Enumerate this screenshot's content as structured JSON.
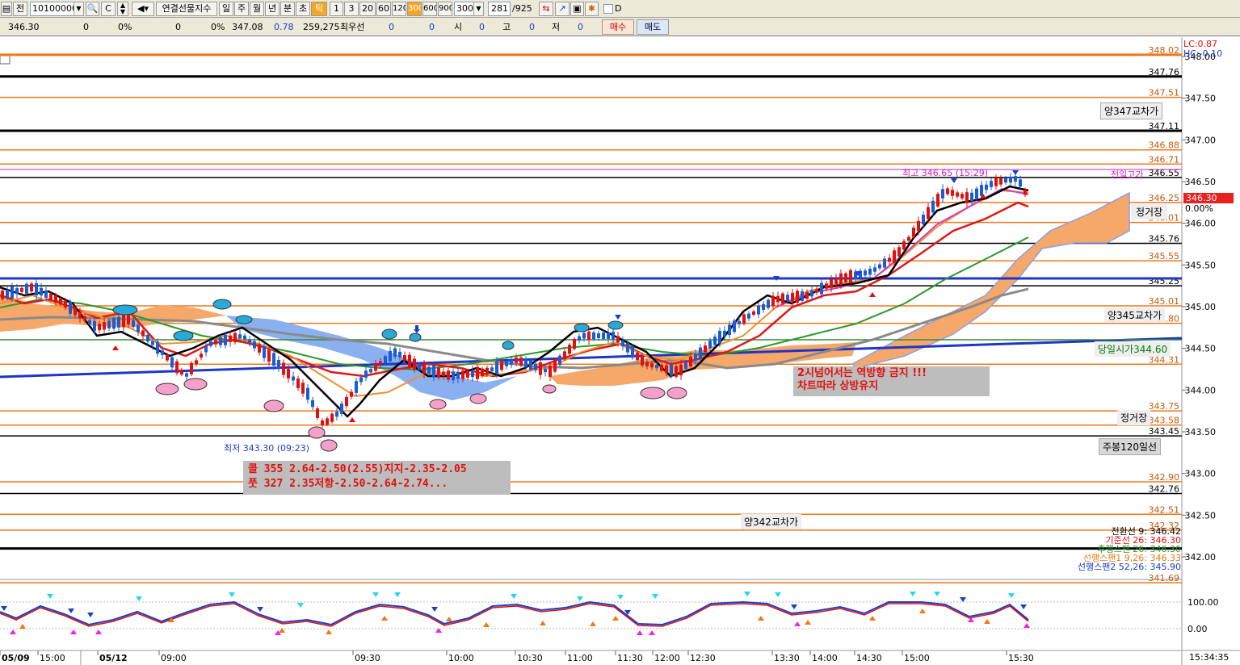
{
  "toolbar": {
    "market_label": "전",
    "code_value": "10100000",
    "index_name": "연결선물지수",
    "periods": [
      "일",
      "주",
      "월",
      "년",
      "분",
      "초",
      "틱"
    ],
    "selected_period": "틱",
    "intervals": [
      "1",
      "3",
      "20",
      "60",
      "120",
      "300",
      "600",
      "900"
    ],
    "selected_interval": "300",
    "interval_value": "300",
    "page_current": "281",
    "page_total": "/925",
    "checkbox_label": "D"
  },
  "infobar": {
    "price": "346.30",
    "v1": "0",
    "p1": "0%",
    "v2": "0",
    "p2": "0%",
    "v3": "347.08",
    "v4": "0.78",
    "volume": "259,275",
    "best_label": "최우선",
    "best_v1": "0",
    "best_v2": "0",
    "open_label": "시",
    "open_val": "0",
    "high_label": "고",
    "high_val": "0",
    "low_label": "저",
    "low_val": "0",
    "buy_button": "매수",
    "sell_button": "매도"
  },
  "colors": {
    "up": "#e01010",
    "down": "#1a5cd6",
    "orange_level": "#f07818",
    "black_level": "#000000",
    "cloud": "#f5a86a",
    "blue_line": "#1d36c8"
  },
  "price_axis": {
    "ticks": [
      "348.00",
      "347.50",
      "347.00",
      "346.50",
      "346.00",
      "345.50",
      "345.00",
      "344.50",
      "344.00",
      "343.50",
      "343.00",
      "342.50",
      "342.00"
    ],
    "current_price": "346.30",
    "current_change": "0.00%"
  },
  "level_labels": {
    "l_34802": "348.02",
    "l_34776": "347.76",
    "l_34751": "347.51",
    "l_34711": "347.11",
    "l_34688": "346.88",
    "l_34671": "346.71",
    "l_34655": "346.55",
    "l_34625": "346.25",
    "l_34601": "346.01",
    "l_34576": "345.76",
    "l_34555": "345.55",
    "l_34525": "345.25",
    "l_34501": "345.01",
    "l_34480": "344.80",
    "l_34431": "344.31",
    "l_34375": "343.75",
    "l_34358": "343.58",
    "l_34345": "343.45",
    "l_34290": "342.90",
    "l_34276": "342.76",
    "l_34251": "342.51",
    "l_34232": "342.32",
    "l_34169": "341.69"
  },
  "annotations": {
    "lc": "LC:0.87",
    "hc": "HC:-0.10",
    "cross_347": "양347교차가",
    "prev_high": "전일고가",
    "regular_1": "정거장",
    "cross_345": "양345교차가",
    "today_open": "당일시가344.60",
    "regular_2": "정거장",
    "weekly_120": "주봉120일선",
    "cross_342": "양342교차가",
    "high_mark": "최고 346.65 (15:29)",
    "low_mark": "최저 343.30 (09:23)",
    "note_line1": "2시넘어서는 역방향 금지 !!!",
    "note_line2": "차트따라 상방유지",
    "option_call": "콜 355 2.64-2.50(2.55)지지-2.35-2.05",
    "option_put": "풋 327 2.35저항-2.50-2.64-2.74...",
    "ichimoku_1": "전환선 9: 346.42",
    "ichimoku_2": "기준선 26: 346.30",
    "ichimoku_3": "후행스팬 26: 346.30",
    "ichimoku_4": "선행스팬1 9,26: 346.33",
    "ichimoku_5": "선행스팬2 52,26: 345.90"
  },
  "osc_axis": {
    "top": "100.00",
    "zero": "0.00"
  },
  "time_axis": {
    "labels": [
      "05/09",
      "15:00",
      "05/12",
      "09:00",
      "09:30",
      "10:00",
      "10:30",
      "11:00",
      "11:30",
      "12:00",
      "12:30",
      "13:30",
      "14:00",
      "14:30",
      "15:00",
      "15:30"
    ],
    "clock": "15:34:35"
  }
}
